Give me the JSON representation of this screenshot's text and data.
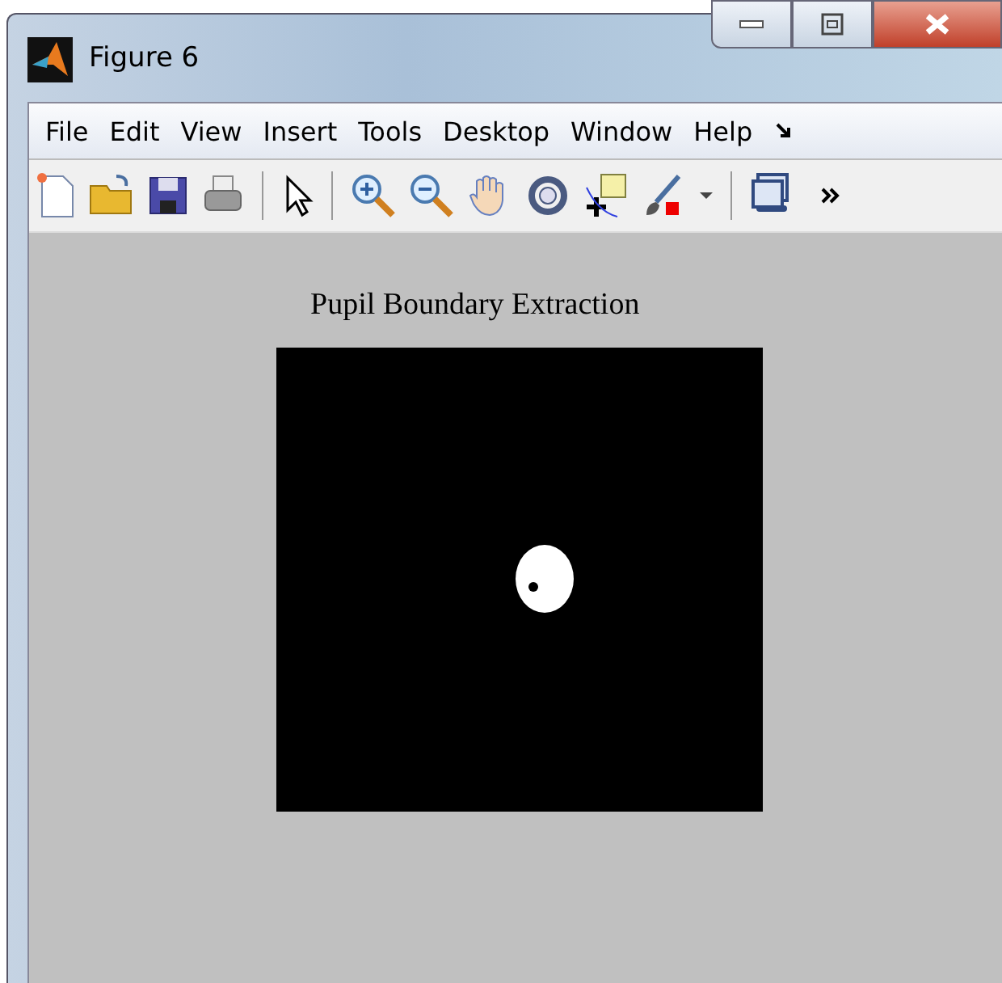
{
  "window": {
    "title": "Figure 6"
  },
  "menu": [
    {
      "label": "File"
    },
    {
      "label": "Edit"
    },
    {
      "label": "View"
    },
    {
      "label": "Insert"
    },
    {
      "label": "Tools"
    },
    {
      "label": "Desktop"
    },
    {
      "label": "Window"
    },
    {
      "label": "Help"
    }
  ],
  "axes": {
    "title": "Pupil Boundary Extraction"
  }
}
